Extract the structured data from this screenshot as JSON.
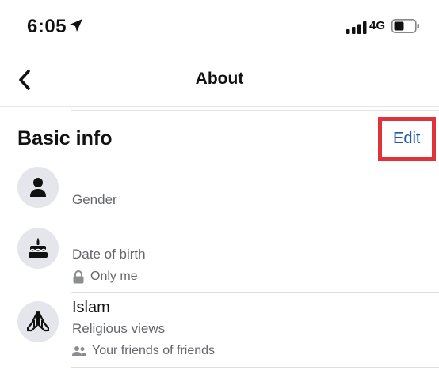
{
  "status_bar": {
    "time": "6:05",
    "network": "4G",
    "icons": [
      "location-arrow-icon",
      "signal-bars-icon",
      "battery-icon"
    ]
  },
  "nav": {
    "title": "About",
    "back_icon": "chevron-left-icon"
  },
  "section": {
    "title": "Basic info",
    "edit_label": "Edit",
    "highlight_color": "#e0323a"
  },
  "rows": [
    {
      "icon": "person-icon",
      "value": "",
      "label": "Gender",
      "privacy": ""
    },
    {
      "icon": "cake-icon",
      "value": "",
      "label": "Date of birth",
      "privacy": "Only me",
      "privacy_icon": "lock-icon"
    },
    {
      "icon": "praying-hands-icon",
      "value": "Islam",
      "label": "Religious views",
      "privacy": "Your friends of friends",
      "privacy_icon": "friends-icon"
    }
  ],
  "colors": {
    "accent": "#1f5ca8",
    "secondary_text": "#65676b",
    "icon_bg": "#e4e6eb"
  }
}
